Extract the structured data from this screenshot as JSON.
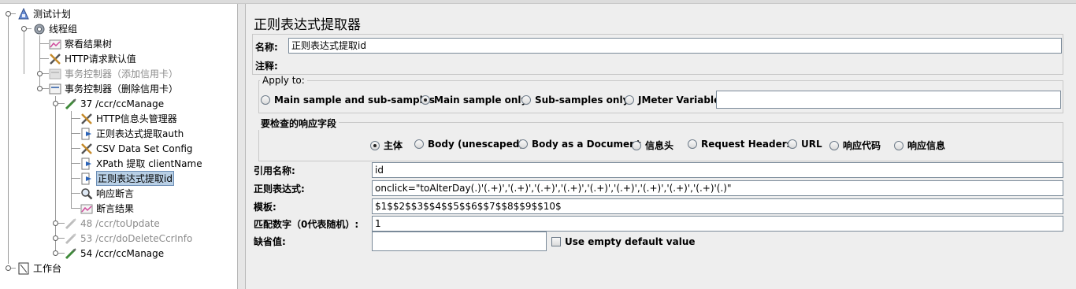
{
  "tree": {
    "items": [
      {
        "label": "测试计划",
        "icon": "test-plan-icon"
      },
      {
        "label": "线程组",
        "icon": "thread-group-gear-icon"
      },
      {
        "label": "察看结果树",
        "icon": "results-tree-chart-icon"
      },
      {
        "label": "HTTP请求默认值",
        "icon": "http-defaults-wrench-icon"
      },
      {
        "label": "事务控制器（添加信用卡）",
        "icon": "transaction-controller-icon",
        "disabled": true
      },
      {
        "label": "事务控制器（删除信用卡）",
        "icon": "transaction-controller-icon"
      },
      {
        "label": "37 /ccr/ccManage",
        "icon": "http-sampler-pipette-icon"
      },
      {
        "label": "HTTP信息头管理器",
        "icon": "header-manager-wrench-icon"
      },
      {
        "label": "正则表达式提取auth",
        "icon": "post-processor-arrow-icon"
      },
      {
        "label": "CSV Data Set Config",
        "icon": "config-wrench-icon"
      },
      {
        "label": "XPath 提取 clientName",
        "icon": "post-processor-arrow-icon"
      },
      {
        "label": "正则表达式提取id",
        "icon": "post-processor-arrow-icon",
        "selected": true
      },
      {
        "label": "响应断言",
        "icon": "magnifier-icon"
      },
      {
        "label": "断言结果",
        "icon": "results-chart-icon"
      },
      {
        "label": "48 /ccr/toUpdate",
        "icon": "http-sampler-pipette-icon",
        "disabled": true
      },
      {
        "label": "53 /ccr/doDeleteCcrInfo",
        "icon": "http-sampler-pipette-icon",
        "disabled": true
      },
      {
        "label": "54 /ccr/ccManage",
        "icon": "http-sampler-pipette-icon"
      },
      {
        "label": "工作台",
        "icon": "workbench-icon"
      }
    ]
  },
  "panel": {
    "title": "正则表达式提取器",
    "name_label": "名称:",
    "name_value": "正则表达式提取id",
    "comment_label": "注释:",
    "comment_value": "",
    "apply_to": {
      "title": "Apply to:",
      "options": [
        "Main sample and sub-samples",
        "Main sample only",
        "Sub-samples only",
        "JMeter Variable"
      ],
      "selected": "Main sample only",
      "variable_value": ""
    },
    "field_check": {
      "title": "要检查的响应字段",
      "options": [
        "主体",
        "Body (unescaped)",
        "Body as a Document",
        "信息头",
        "Request Headers",
        "URL",
        "响应代码",
        "响应信息"
      ],
      "selected": "主体"
    },
    "ref_name_label": "引用名称:",
    "ref_name_value": "id",
    "regex_label": "正则表达式:",
    "regex_value": "onclick=\"toAlterDay(.)'(.+)','(.+)','(.+)','(.+)','(.+)','(.+)','(.+)','(.+)','(.+)'(.)\"",
    "template_label": "模板:",
    "template_value": "$1$$2$$3$$4$$5$$6$$7$$8$$9$$10$",
    "match_label": "匹配数字（0代表随机）:",
    "match_value": "1",
    "default_label": "缺省值:",
    "default_value": "",
    "use_empty_label": "Use empty default value"
  },
  "colors": {
    "selected_bg": "#b8cfe5",
    "disabled_text": "#8c8c8c"
  }
}
